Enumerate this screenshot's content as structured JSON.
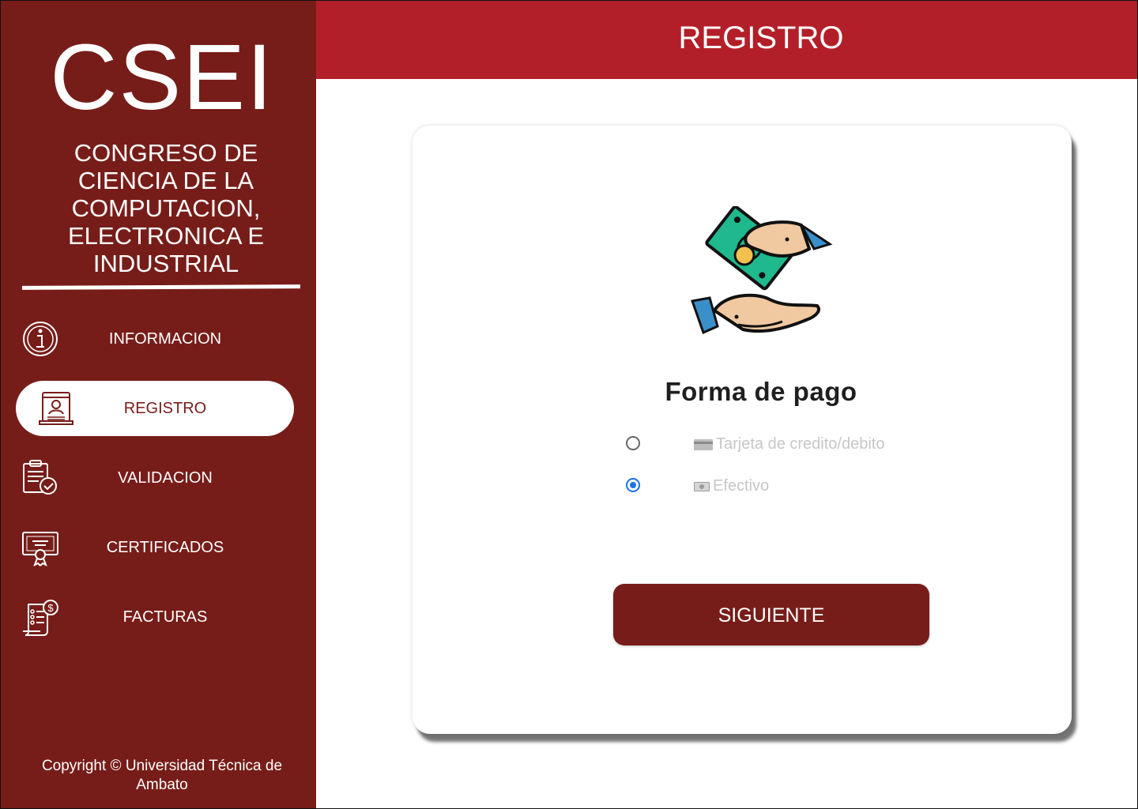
{
  "sidebar": {
    "logo": "CSEI",
    "subtitle": "CONGRESO DE CIENCIA DE LA COMPUTACION, ELECTRONICA E INDUSTRIAL",
    "items": [
      {
        "label": "INFORMACION",
        "icon": "info-icon"
      },
      {
        "label": "REGISTRO",
        "icon": "registration-icon",
        "active": true
      },
      {
        "label": "VALIDACION",
        "icon": "clipboard-check-icon"
      },
      {
        "label": "CERTIFICADOS",
        "icon": "certificate-icon"
      },
      {
        "label": "FACTURAS",
        "icon": "invoice-icon"
      }
    ],
    "copyright": "Copyright © Universidad Técnica de Ambato"
  },
  "header": {
    "title": "REGISTRO"
  },
  "card": {
    "title": "Forma de pago",
    "illustration": "hand-money-payment-icon",
    "options": [
      {
        "label": "Tarjeta de credito/debito",
        "icon": "credit-card-icon",
        "checked": false
      },
      {
        "label": "Efectivo",
        "icon": "cash-icon",
        "checked": true
      }
    ],
    "next_label": "SIGUIENTE"
  },
  "colors": {
    "sidebar": "#771d19",
    "header": "#b31f28",
    "radio_checked": "#1a73e8"
  }
}
